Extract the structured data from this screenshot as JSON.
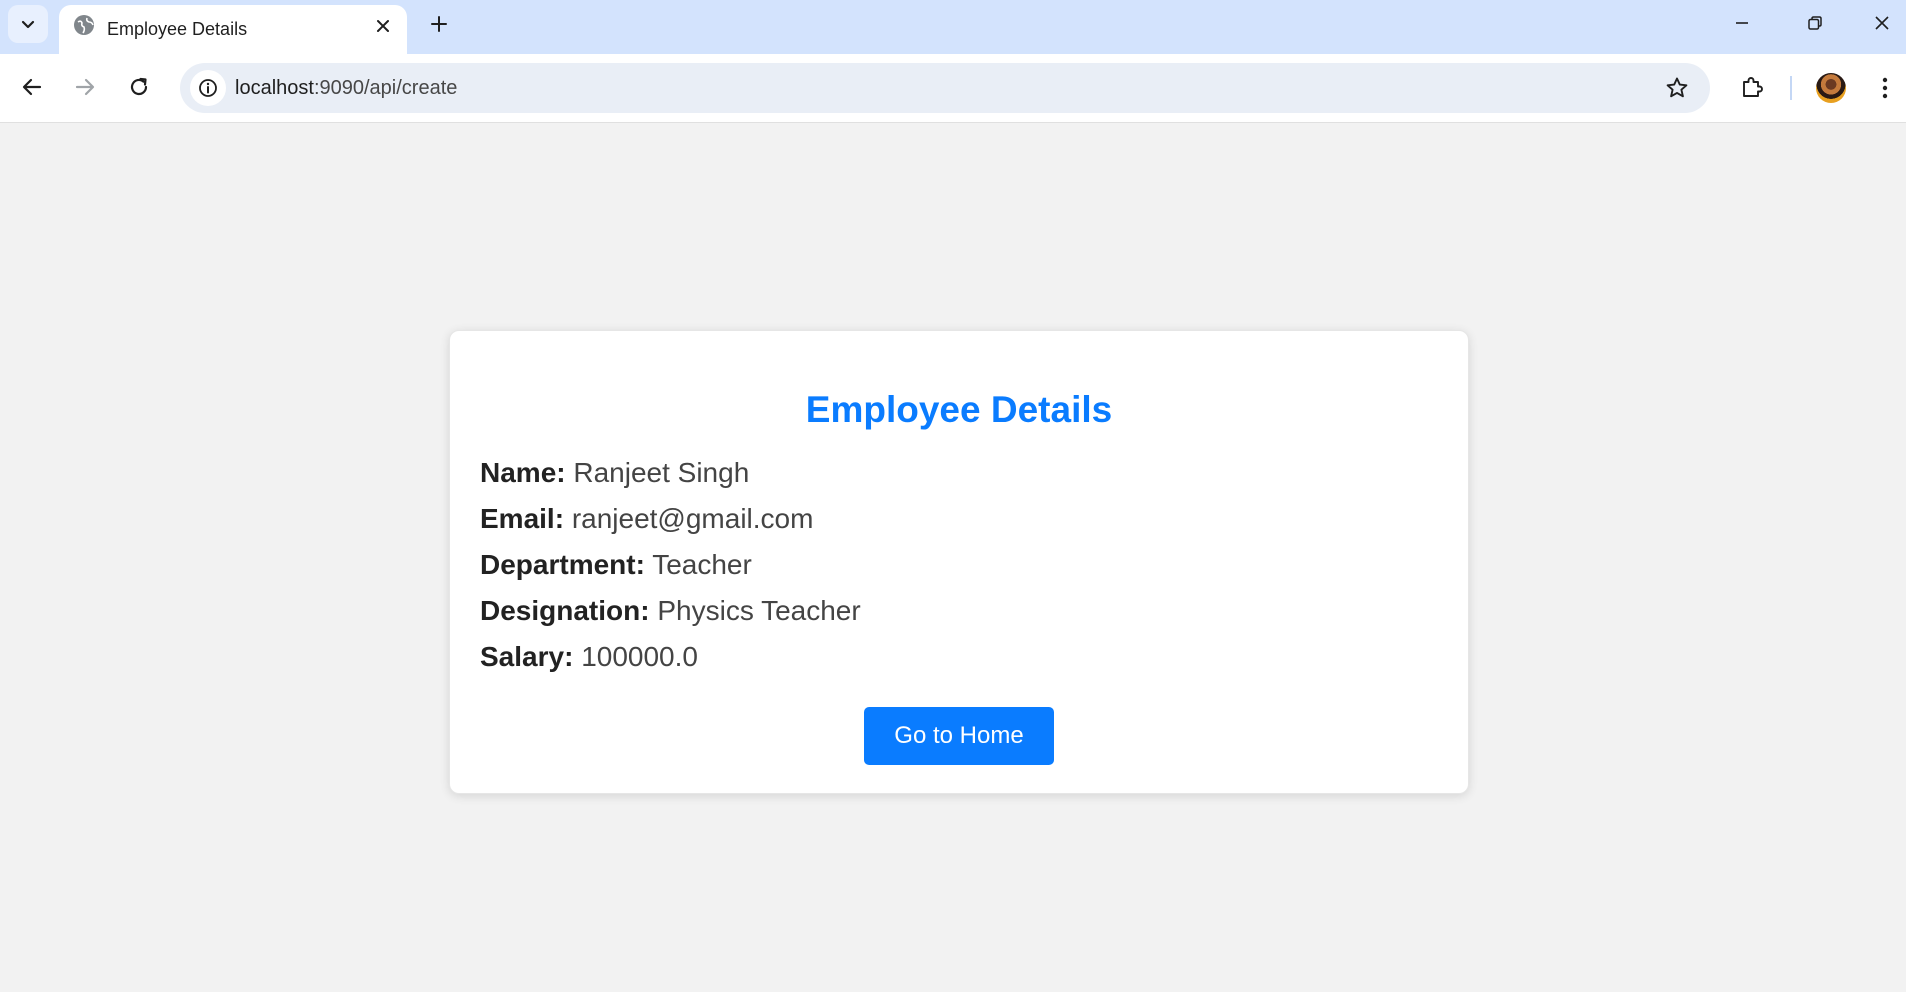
{
  "browser": {
    "tab_title": "Employee Details",
    "url_host": "localhost",
    "url_path": ":9090/api/create"
  },
  "page": {
    "title": "Employee Details",
    "fields": [
      {
        "label": "Name:",
        "value": "Ranjeet Singh"
      },
      {
        "label": "Email:",
        "value": "ranjeet@gmail.com"
      },
      {
        "label": "Department:",
        "value": "Teacher"
      },
      {
        "label": "Designation:",
        "value": "Physics Teacher"
      },
      {
        "label": "Salary:",
        "value": "100000.0"
      }
    ],
    "home_button_label": "Go to Home"
  },
  "colors": {
    "accent": "#0a7cff",
    "page_background": "#f2f2f2",
    "tabstrip": "#d3e3fd"
  },
  "icons": {
    "tab_search": "chevron-down-icon",
    "favicon": "globe-icon",
    "tab_close": "close-icon",
    "new_tab": "plus-icon",
    "minimize": "minimize-icon",
    "restore": "restore-icon",
    "close_window": "close-icon",
    "back": "arrow-left-icon",
    "forward": "arrow-right-icon",
    "reload": "reload-icon",
    "site_info": "info-icon",
    "bookmark": "star-icon",
    "extensions": "puzzle-icon",
    "menu": "more-vertical-icon"
  }
}
